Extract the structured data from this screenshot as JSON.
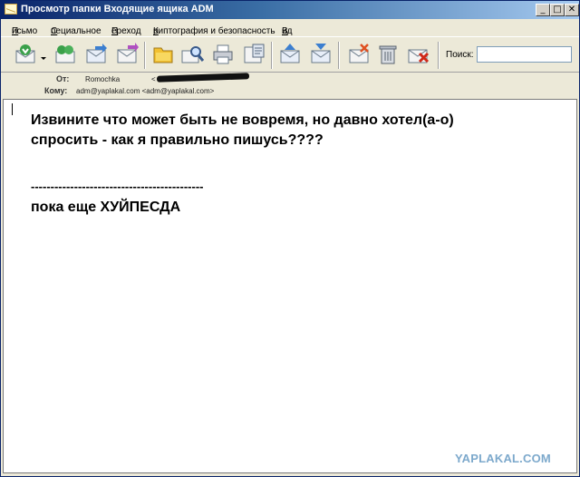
{
  "window": {
    "title": "Просмотр папки Входящие ящика ADM",
    "min_symbol": "_",
    "max_symbol": "□",
    "close_symbol": "✕"
  },
  "menu": [
    {
      "u": "П",
      "rest": "исьмо"
    },
    {
      "u": "С",
      "rest": "пециальное"
    },
    {
      "u": "П",
      "rest": "ереход"
    },
    {
      "u": "К",
      "rest": "риптография и безопасность"
    },
    {
      "u": "В",
      "rest": "ид"
    }
  ],
  "toolbar": {
    "buttons": [
      {
        "icon": "receive-mail-icon"
      },
      {
        "icon": "dropdown-arrow-icon"
      },
      {
        "icon": "address-book-icon"
      },
      {
        "icon": "forward-icon"
      },
      {
        "icon": "send-receive-icon"
      },
      {
        "icon": "folder-icon"
      },
      {
        "icon": "find-message-icon"
      },
      {
        "icon": "print-icon"
      },
      {
        "icon": "properties-icon"
      },
      {
        "icon": "previous-message-icon"
      },
      {
        "icon": "next-message-icon"
      },
      {
        "icon": "delete-mark-icon"
      },
      {
        "icon": "trash-icon"
      },
      {
        "icon": "delete-message-icon"
      }
    ],
    "search_label": "Поиск:",
    "search_value": ""
  },
  "headers": {
    "from_label": "От:",
    "from_name": "Romochka",
    "from_email_open": "<",
    "to_label": "Кому:",
    "to_value": "adm@yaplakal.com <adm@yaplakal.com>"
  },
  "message": {
    "line1": "Извините что может быть не вовремя, но давно хотел(а-о)",
    "line2": "спросить - как я правильно пишусь????",
    "separator": "--------------------------------------------",
    "line3": "пока еще ХУЙПЕСДА"
  },
  "watermark": "YAPLAKAL.COM",
  "colors": {
    "title_gradient_start": "#0a246a",
    "title_gradient_end": "#a6caf0",
    "chrome": "#ece9d8",
    "watermark": "#7da9cc"
  }
}
